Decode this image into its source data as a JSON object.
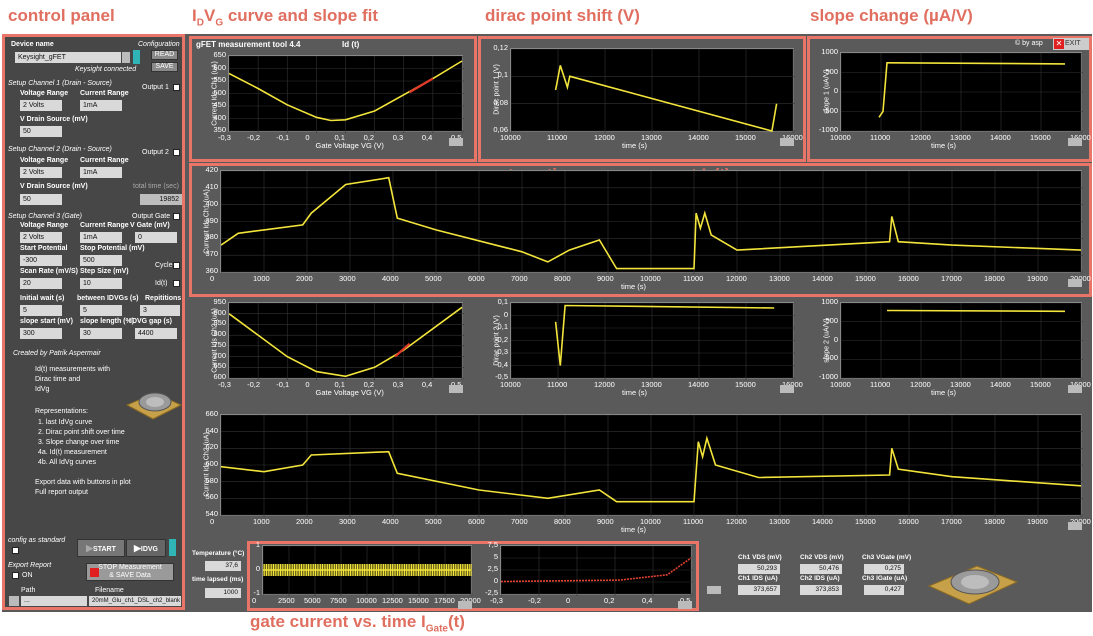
{
  "headers": {
    "control_panel": "control panel",
    "idvg_pre": "I",
    "idvg_sub1": "D",
    "idvg_mid": "V",
    "idvg_sub2": "G",
    "idvg_post": " curve and slope fit",
    "dirac": "dirac point shift (V)",
    "slope": "slope change (µA/V)",
    "id_time_pre": "current vs. time measurement I",
    "id_time_sub": "D",
    "id_time_post": "(t)",
    "gate_pre": "gate current vs. time I",
    "gate_sub": "Gate",
    "gate_post": "(t)"
  },
  "window": {
    "title": "gFET measurement tool 4.4",
    "id_label": "Id (t)",
    "credit": "© by asp",
    "exit": "EXIT"
  },
  "control": {
    "device_name_label": "Device name",
    "device_name": "Keysight_gFET",
    "configuration": "Configuration",
    "read": "READ",
    "save": "SAVE",
    "connected": "Keysight connected",
    "ch1_title": "Setup Channel 1 (Drain - Source)",
    "output1": "Output 1",
    "ch1_vrange_lbl": "Voltage Range",
    "ch1_crange_lbl": "Current Range",
    "ch1_vrange": "2 Volts",
    "ch1_crange": "1mA",
    "ch1_vds_lbl": "V Drain Source (mV)",
    "ch1_vds": "50",
    "ch2_title": "Setup Channel 2 (Drain - Source)",
    "output2": "Output 2",
    "ch2_vrange_lbl": "Voltage Range",
    "ch2_crange_lbl": "Current Range",
    "ch2_vrange": "2 Volts",
    "ch2_crange": "1mA",
    "ch2_vds_lbl": "V Drain Source (mV)",
    "ch2_vds": "50",
    "total_time_lbl": "total time (sec)",
    "total_time": "19852",
    "ch3_title": "Setup Channel 3 (Gate)",
    "output_gate": "Output Gate",
    "ch3_vrange_lbl": "Voltage Range",
    "ch3_crange_lbl": "Current Range",
    "ch3_vgate_lbl": "V Gate (mV)",
    "ch3_vrange": "2 Volts",
    "ch3_crange": "1mA",
    "ch3_vgate": "0",
    "start_pot_lbl": "Start Potential",
    "stop_pot_lbl": "Stop Potential (mV)",
    "start_pot": "-300",
    "stop_pot": "500",
    "cycle": "Cycle",
    "scan_rate_lbl": "Scan Rate (mV/S)",
    "step_size_lbl": "Step Size (mV)",
    "scan_rate": "20",
    "step_size": "10",
    "idt": "Id(t)",
    "initial_wait_lbl": "Initial wait (s)",
    "between_lbl": "between IDVGs (s)",
    "repetitions_lbl": "Repititions",
    "initial_wait": "5",
    "between": "5",
    "repetitions": "3",
    "slope_start_lbl": "slope start (mV)",
    "slope_length_lbl": "slope length (%)",
    "idvg_gap_lbl": "IDVG gap (s)",
    "slope_start": "300",
    "slope_length": "30",
    "idvg_gap": "4400",
    "created_by": "Created by Patrik Aspermair",
    "desc1": "Id(t) measurements with",
    "desc2": "Dirac time and",
    "desc3": "IdVg",
    "rep_title": "Representations:",
    "rep1": "1. last IdVg curve",
    "rep2": "2. Dirac point shift over time",
    "rep3": "3. Slope change over time",
    "rep4a": "4a. Id(t) measurement",
    "rep4b": "4b. All IdVg curves",
    "export1": "Export data with buttons in plot",
    "export2": "Full report output",
    "config_std": "config as standard",
    "start": "START",
    "idvg": "IDVG",
    "export_report": "Export Report",
    "on": "ON",
    "stop1": "STOP Measurement",
    "stop2": "& SAVE Data",
    "path_lbl": "Path",
    "filename_lbl": "Filename",
    "path": "...",
    "filename": "20mM_Glu_ch1_DSL_ch2_blank"
  },
  "bottom": {
    "temp_lbl": "Temperature (°C)",
    "temp": "37,6",
    "lapsed_lbl": "time lapsed (ms)",
    "lapsed": "1000",
    "ch1_vds_lbl": "Ch1 VDS (mV)",
    "ch1_vds": "50,293",
    "ch1_ids_lbl": "Ch1 IDS (uA)",
    "ch1_ids": "373,657",
    "ch2_vds_lbl": "Ch2 VDS (mV)",
    "ch2_vds": "50,476",
    "ch2_ids_lbl": "Ch2 IDS (uA)",
    "ch2_ids": "373,853",
    "ch3_vg_lbl": "Ch3 VGate (mV)",
    "ch3_vg": "0,275",
    "ch3_ig_lbl": "Ch3 IGate (uA)",
    "ch3_ig": "0,427"
  },
  "chart_data": [
    {
      "id": "idvg1",
      "type": "line",
      "xlabel": "Gate Voltage VG (V)",
      "ylabel": "Current Ids Ch1 (uA)",
      "xlim": [
        -0.3,
        0.5
      ],
      "ylim": [
        350,
        650
      ],
      "xticks": [
        "-0,3",
        "-0,2",
        "-0,1",
        "0",
        "0,1",
        "0,2",
        "0,3",
        "0,4",
        "0,5"
      ],
      "yticks": [
        "350",
        "400",
        "450",
        "500",
        "550",
        "600",
        "650"
      ],
      "x": [
        -0.3,
        -0.2,
        -0.1,
        0,
        0.05,
        0.1,
        0.2,
        0.3,
        0.4,
        0.5
      ],
      "y": [
        580,
        520,
        455,
        405,
        392,
        395,
        430,
        495,
        560,
        630
      ]
    },
    {
      "id": "dirac1",
      "type": "line",
      "xlabel": "time (s)",
      "ylabel": "Dirac point 1 (V)",
      "xlim": [
        10000,
        16000
      ],
      "ylim": [
        0.06,
        0.12
      ],
      "xticks": [
        "10000",
        "11000",
        "12000",
        "13000",
        "14000",
        "15000",
        "16000"
      ],
      "yticks": [
        "0,06",
        "0,08",
        "0,1",
        "0,12"
      ],
      "x": [
        10950,
        11050,
        11200,
        11250,
        15550,
        15650
      ],
      "y": [
        0.09,
        0.108,
        0.092,
        0.1,
        0.06,
        0.08
      ]
    },
    {
      "id": "slope1",
      "type": "line",
      "xlabel": "time (s)",
      "ylabel": "slope 1 (uA/V)",
      "xlim": [
        10000,
        16000
      ],
      "ylim": [
        -1000,
        1000
      ],
      "xticks": [
        "10000",
        "11000",
        "12000",
        "13000",
        "14000",
        "15000",
        "16000"
      ],
      "yticks": [
        "-1000",
        "-500",
        "0",
        "500",
        "1000"
      ],
      "x": [
        10950,
        11050,
        11150,
        15600
      ],
      "y": [
        -650,
        -500,
        750,
        720
      ]
    },
    {
      "id": "idt1",
      "type": "line",
      "xlabel": "time (s)",
      "ylabel": "Current Ids Ch1 (uA)",
      "xlim": [
        0,
        20000
      ],
      "ylim": [
        360,
        420
      ],
      "xticks": [
        "0",
        "1000",
        "2000",
        "3000",
        "4000",
        "5000",
        "6000",
        "7000",
        "8000",
        "9000",
        "10000",
        "11000",
        "12000",
        "13000",
        "14000",
        "15000",
        "16000",
        "17000",
        "18000",
        "19000",
        "20000"
      ],
      "yticks": [
        "360",
        "370",
        "380",
        "390",
        "400",
        "410",
        "420"
      ],
      "x": [
        0,
        400,
        1000,
        1900,
        2100,
        2900,
        3900,
        4100,
        5000,
        7000,
        7600,
        8100,
        8800,
        9200,
        11000,
        11050,
        11150,
        11250,
        11400,
        12000,
        15550,
        15600,
        15750,
        17000,
        20000
      ],
      "y": [
        376,
        383,
        385,
        388,
        395,
        412,
        416,
        392,
        385,
        372,
        366,
        373,
        379,
        362,
        362,
        395,
        386,
        395,
        382,
        373,
        378,
        393,
        378,
        376,
        373
      ]
    },
    {
      "id": "idvg2",
      "type": "line",
      "xlabel": "Gate Voltage VG (V)",
      "ylabel": "Current Ids Ch2 (uA)",
      "xlim": [
        -0.3,
        0.5
      ],
      "ylim": [
        600,
        950
      ],
      "xticks": [
        "-0,3",
        "-0,2",
        "-0,1",
        "0",
        "0,1",
        "0,2",
        "0,3",
        "0,4",
        "0,5"
      ],
      "yticks": [
        "600",
        "650",
        "700",
        "750",
        "800",
        "850",
        "900",
        "950"
      ],
      "x": [
        -0.3,
        -0.2,
        -0.1,
        0,
        0.1,
        0.2,
        0.3,
        0.4,
        0.5
      ],
      "y": [
        900,
        800,
        700,
        630,
        608,
        650,
        730,
        830,
        930
      ]
    },
    {
      "id": "dirac2",
      "type": "line",
      "xlabel": "time (s)",
      "ylabel": "Dirac point 2 (V)",
      "xlim": [
        10000,
        16000
      ],
      "ylim": [
        -0.5,
        0.1
      ],
      "xticks": [
        "10000",
        "11000",
        "12000",
        "13000",
        "14000",
        "15000",
        "16000"
      ],
      "yticks": [
        "-0,5",
        "-0,4",
        "-0,3",
        "-0,2",
        "-0,1",
        "0",
        "0,1"
      ],
      "x": [
        10950,
        11050,
        11150,
        15600
      ],
      "y": [
        -0.05,
        -0.4,
        0.08,
        0.06
      ]
    },
    {
      "id": "slope2",
      "type": "line",
      "xlabel": "time (s)",
      "ylabel": "slope 2 (uA/V)",
      "xlim": [
        10000,
        16000
      ],
      "ylim": [
        -1000,
        1000
      ],
      "xticks": [
        "10000",
        "11000",
        "12000",
        "13000",
        "14000",
        "15000",
        "16000"
      ],
      "yticks": [
        "-1000",
        "-500",
        "0",
        "500",
        "1000"
      ],
      "x": [
        11150,
        15600
      ],
      "y": [
        800,
        780
      ]
    },
    {
      "id": "idt2",
      "type": "line",
      "xlabel": "time (s)",
      "ylabel": "Current Ids Ch2 (uA)",
      "xlim": [
        0,
        20000
      ],
      "ylim": [
        540,
        660
      ],
      "xticks": [
        "0",
        "1000",
        "2000",
        "3000",
        "4000",
        "5000",
        "6000",
        "7000",
        "8000",
        "9000",
        "10000",
        "11000",
        "12000",
        "13000",
        "14000",
        "15000",
        "16000",
        "17000",
        "18000",
        "19000",
        "20000"
      ],
      "yticks": [
        "540",
        "560",
        "580",
        "600",
        "620",
        "640",
        "660"
      ],
      "x": [
        0,
        1000,
        1900,
        2100,
        3900,
        4100,
        6000,
        7600,
        8800,
        9200,
        11000,
        11100,
        11200,
        11300,
        11500,
        12500,
        15550,
        15600,
        15750,
        17000,
        20000
      ],
      "y": [
        598,
        592,
        600,
        612,
        616,
        590,
        570,
        560,
        570,
        556,
        556,
        628,
        610,
        632,
        600,
        585,
        588,
        620,
        595,
        586,
        575
      ]
    },
    {
      "id": "igate",
      "type": "line",
      "xlabel": "",
      "ylabel": "",
      "xlim": [
        0,
        20000
      ],
      "ylim": [
        -1,
        1
      ],
      "xticks": [
        "0",
        "2500",
        "5000",
        "7500",
        "10000",
        "12500",
        "15000",
        "17500",
        "20000"
      ],
      "yticks": [
        "-1",
        "0",
        "1"
      ],
      "x": [
        0,
        20000
      ],
      "y": [
        0,
        0
      ]
    },
    {
      "id": "igate_vg",
      "type": "line",
      "xlabel": "",
      "ylabel": "",
      "xlim": [
        -0.3,
        0.5
      ],
      "ylim": [
        -2.5,
        7.5
      ],
      "xticks": [
        "-0,3",
        "-0,2",
        "0",
        "0,2",
        "0,4",
        "0,5"
      ],
      "yticks": [
        "-2,5",
        "0",
        "2,5",
        "5",
        "7,5"
      ],
      "x": [
        -0.3,
        0.2,
        0.4,
        0.5
      ],
      "y": [
        0.1,
        0.4,
        1.5,
        5
      ]
    }
  ]
}
